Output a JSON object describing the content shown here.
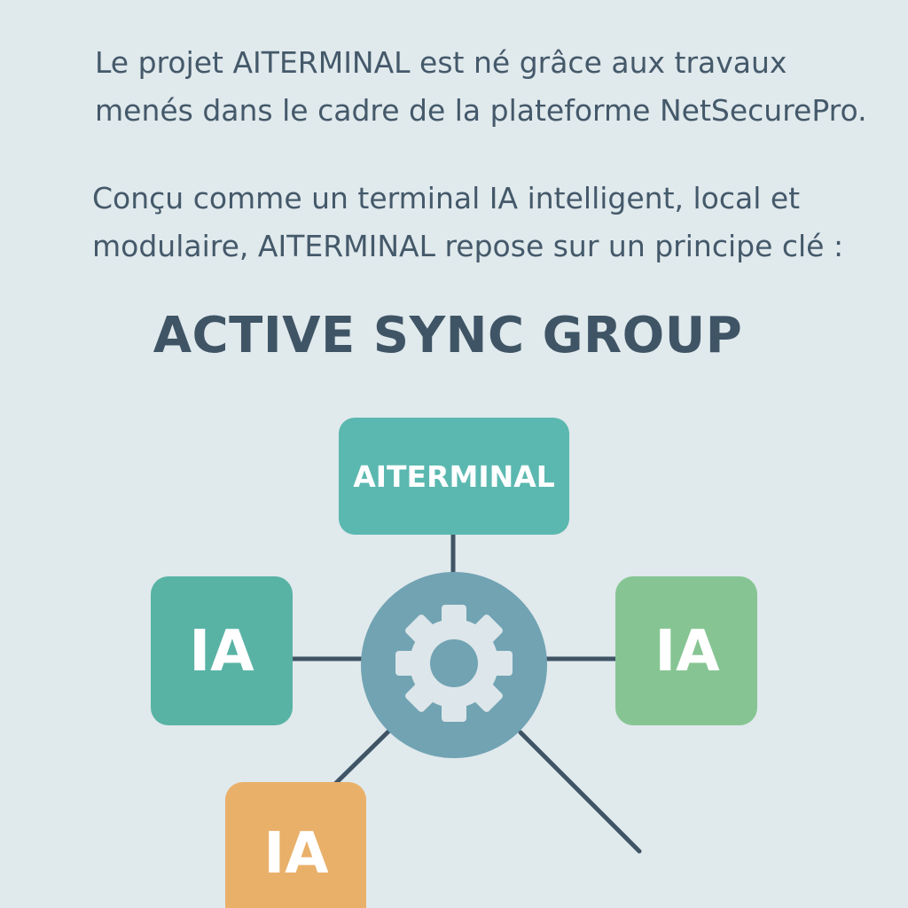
{
  "intro": {
    "paragraph_1": [
      "Le projet AITERMINAL est né grâce aux travaux",
      "menés dans le cadre de la plateforme NetSecurePro."
    ],
    "paragraph_2": [
      "Conçu comme un terminal IA intelligent, local et",
      "modulaire, AITERMINAL repose sur un principe clé :"
    ]
  },
  "heading": "ACTIVE SYNC GROUP",
  "diagram": {
    "hub_icon": "gear-icon",
    "nodes": {
      "top": {
        "label": "AITERMINAL",
        "color": "#5bb8b0"
      },
      "left": {
        "label": "IA",
        "color": "#58b3a5"
      },
      "right": {
        "label": "IA",
        "color": "#86c593"
      },
      "bottom_left": {
        "label": "IA",
        "color": "#e9b06a"
      }
    },
    "hub_color": "#71a3b3",
    "line_color": "#3f5566"
  }
}
